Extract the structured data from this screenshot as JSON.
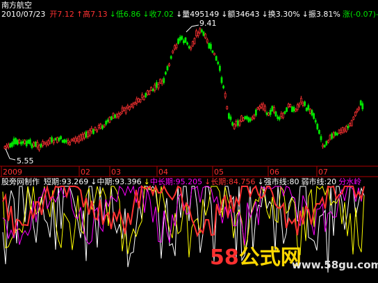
{
  "colors": {
    "up": "#ff3232",
    "down": "#00e600",
    "white": "#ffffff",
    "yellow": "#ffff00",
    "magenta": "#ff00ff",
    "grid": "#b00000",
    "volcolor": "#ffff00"
  },
  "stock": {
    "name": "南方航空",
    "date": "2010/07/23",
    "open_label": "开",
    "open": "7.12",
    "high_label": "高",
    "high": "7.13",
    "low_label": "低",
    "low": "6.86",
    "close_label": "收",
    "close": "7.02",
    "volume_label": "量",
    "volume": "495149",
    "amount_label": "额",
    "amount": "34643",
    "turnover_label": "换",
    "turnover": "3.30%",
    "amplitude_label": "振",
    "amplitude": "3.81%",
    "change_label": "涨",
    "change": "(-0.07)-"
  },
  "price_chart": {
    "max_label": "9.41",
    "min_label": "5.55",
    "time_labels": [
      "2009",
      "02",
      "03",
      "04",
      "05",
      "06",
      "07"
    ]
  },
  "indicator": {
    "name": "股旁网制作",
    "short_label": "短期:",
    "short_value": "93.269",
    "mid_label": "中期:",
    "mid_value": "93.396",
    "midlong_label": "中长期:",
    "midlong_value": "95.205",
    "long_label": "长期:",
    "long_value": "84.756",
    "strong_label": "强市线:",
    "strong_value": "80",
    "weak_label": "弱市线:",
    "weak_value": "20",
    "tail_text": "分水岭"
  },
  "watermark": {
    "text_num": "58",
    "text_cn": "公式网",
    "url": "www.58gu.com"
  }
}
